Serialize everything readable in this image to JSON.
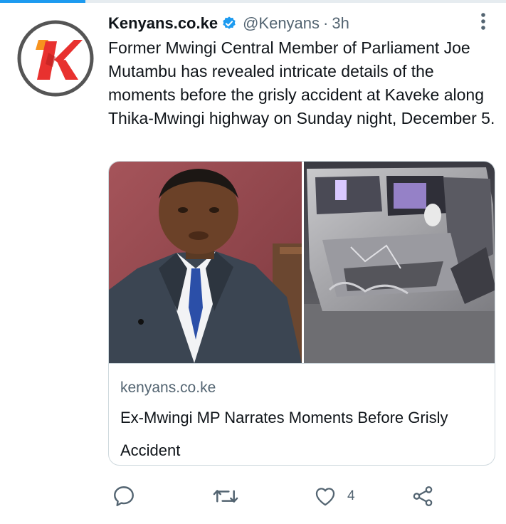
{
  "tweet": {
    "display_name": "Kenyans.co.ke",
    "handle": "@Kenyans",
    "separator": "·",
    "time": "3h",
    "text": "Former Mwingi Central Member of Parliament Joe Mutambu has revealed intricate details of the moments before the grisly accident at Kaveke along Thika-Mwingi highway on Sunday night, December 5."
  },
  "avatar": {
    "logo_letter": "K",
    "colors": {
      "ring": "#555555",
      "red": "#e8312f",
      "orange": "#f7931e"
    }
  },
  "card": {
    "domain": "kenyans.co.ke",
    "title": "Ex-Mwingi MP Narrates Moments Before Grisly Accident"
  },
  "actions": {
    "reply_icon": "reply-icon",
    "retweet_icon": "retweet-icon",
    "like_icon": "heart-icon",
    "like_count": "4",
    "share_icon": "share-icon"
  },
  "colors": {
    "secondary_text": "#536471",
    "verified_blue": "#1d9bf0",
    "border": "#cfd9de"
  }
}
